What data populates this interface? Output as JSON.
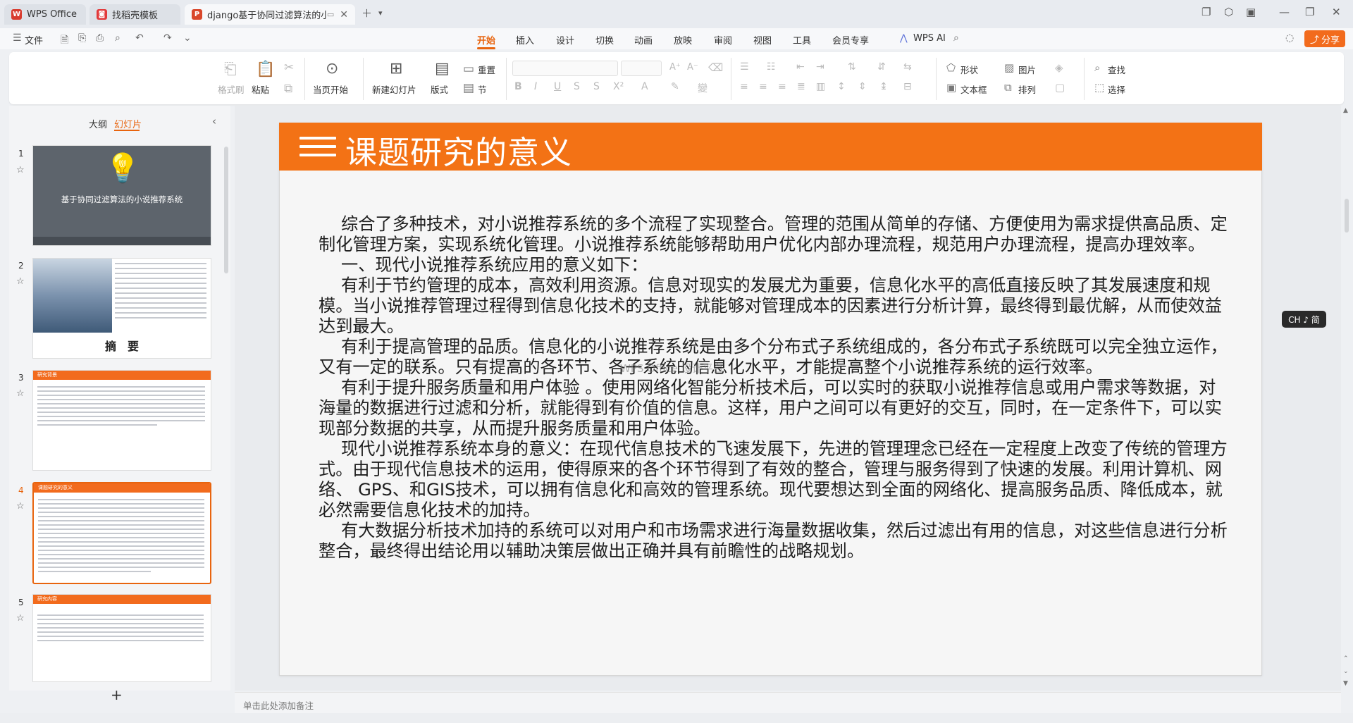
{
  "tabs": [
    {
      "label": "WPS Office",
      "icon": "wps-logo-icon"
    },
    {
      "label": "找稻壳模板",
      "icon": "docer-icon"
    },
    {
      "label": "django基于协同过滤算法的小",
      "icon": "ppt-icon"
    }
  ],
  "menubar": {
    "file_label": "文件",
    "items": [
      "开始",
      "插入",
      "设计",
      "切换",
      "动画",
      "放映",
      "审阅",
      "视图",
      "工具",
      "会员专享"
    ],
    "active_item": "开始",
    "wps_ai_label": "WPS AI",
    "share_label": "分享"
  },
  "ribbon": {
    "format_painter": "格式刷",
    "paste": "粘贴",
    "play_from_current": "当页开始",
    "new_slide": "新建幻灯片",
    "layout": "版式",
    "reset": "重置",
    "section": "节",
    "shape": "形状",
    "picture": "图片",
    "find": "查找",
    "textbox": "文本框",
    "arrange": "排列",
    "select": "选择"
  },
  "sidebar": {
    "tab_outline": "大纲",
    "tab_slides": "幻灯片",
    "active_tab": "幻灯片",
    "slides": [
      {
        "number": "1",
        "title": "基于协同过滤算法的小说推荐系统"
      },
      {
        "number": "2",
        "title": "摘　要"
      },
      {
        "number": "3",
        "title": "研究背景"
      },
      {
        "number": "4",
        "title": "课题研究的意义"
      },
      {
        "number": "5",
        "title": "研究内容"
      }
    ],
    "selected_slide": "4",
    "add_label": "+"
  },
  "slide": {
    "title": "课题研究的意义",
    "paragraphs": [
      "综合了多种技术，对小说推荐系统的多个流程了实现整合。管理的范围从简单的存储、方便使用为需求提供高品质、定制化管理方案，实现系统化管理。小说推荐系统能够帮助用户优化内部办理流程，规范用户办理流程，提高办理效率。",
      "一、现代小说推荐系统应用的意义如下：",
      "有利于节约管理的成本，高效利用资源。信息对现实的发展尤为重要，信息化水平的高低直接反映了其发展速度和规模。当小说推荐管理过程得到信息化技术的支持，就能够对管理成本的因素进行分析计算，最终得到最优解，从而使效益达到最大。",
      "有利于提高管理的品质。信息化的小说推荐系统是由多个分布式子系统组成的，各分布式子系统既可以完全独立运作，又有一定的联系。只有提高的各环节、各子系统的信息化水平，才能提高整个小说推荐系统的运行效率。",
      "有利于提升服务质量和用户体验 。使用网络化智能分析技术后，可以实时的获取小说推荐信息或用户需求等数据，对海量的数据进行过滤和分析，就能得到有价值的信息。这样，用户之间可以有更好的交互，同时，在一定条件下，可以实现部分数据的共享，从而提升服务质量和用户体验。",
      "现代小说推荐系统本身的意义：在现代信息技术的飞速发展下，先进的管理理念已经在一定程度上改变了传统的管理方式。由于现代信息技术的运用，使得原来的各个环节得到了有效的整合，管理与服务得到了快速的发展。利用计算机、网络、 GPS、和GIS技术，可以拥有信息化和高效的管理系统。现代要想达到全面的网络化、提高服务品质、降低成本，就必然需要信息化技术的加持。",
      "有大数据分析技术加持的系统可以对用户和市场需求进行海量数据收集，然后过滤出有用的信息，对这些信息进行分析整合，最终得出结论用以辅助决策层做出正确并具有前瞻性的战略规划。"
    ],
    "watermark": "WPS Office 设计平台"
  },
  "ime_indicator": "CH ♪ 简",
  "notes_placeholder": "单击此处添加备注",
  "colors": {
    "accent": "#f37215",
    "share": "#f26b1d"
  }
}
